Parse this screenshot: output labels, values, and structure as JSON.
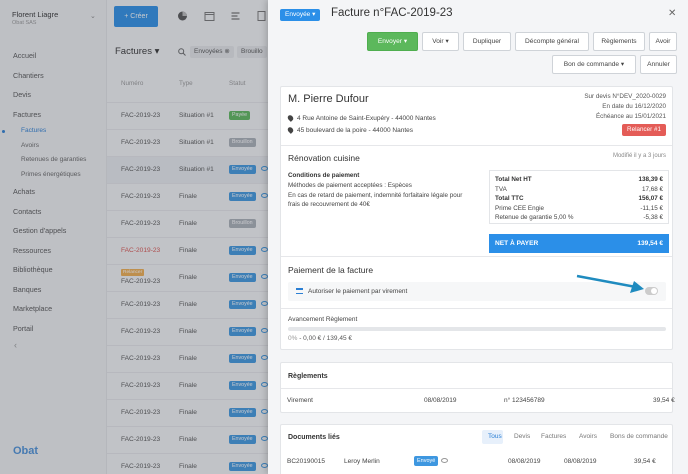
{
  "sidebar": {
    "user_name": "Florent Liagre",
    "company": "Obat SAS",
    "items": [
      {
        "label": "Accueil"
      },
      {
        "label": "Chantiers"
      },
      {
        "label": "Devis"
      },
      {
        "label": "Factures"
      },
      {
        "label": "Factures"
      },
      {
        "label": "Avoirs"
      },
      {
        "label": "Retenues de garanties"
      },
      {
        "label": "Primes énergétiques"
      },
      {
        "label": "Achats"
      },
      {
        "label": "Contacts"
      },
      {
        "label": "Gestion d'appels"
      },
      {
        "label": "Ressources"
      },
      {
        "label": "Bibliothèque"
      },
      {
        "label": "Banques"
      },
      {
        "label": "Marketplace"
      },
      {
        "label": "Portail"
      }
    ],
    "logo": "Obat"
  },
  "toolbar": {
    "create_label": "Créer"
  },
  "list": {
    "title": "Factures",
    "filters": [
      "Envoyées",
      "Brouillo"
    ],
    "columns": [
      "Numéro",
      "Type",
      "Statut"
    ],
    "rows": [
      {
        "num": "FAC-2019-23",
        "type": "Situation #1",
        "status": "Payée"
      },
      {
        "num": "FAC-2019-23",
        "type": "Situation #1",
        "status": "Brouillon"
      },
      {
        "num": "FAC-2019-23",
        "type": "Situation #1",
        "status": "Envoyée"
      },
      {
        "num": "FAC-2019-23",
        "type": "Finale",
        "status": "Envoyée"
      },
      {
        "num": "FAC-2019-23",
        "type": "Finale",
        "status": "Brouillon"
      },
      {
        "num": "FAC-2019-23",
        "type": "Finale",
        "status": "Envoyée"
      },
      {
        "num": "FAC-2019-23",
        "type": "Finale",
        "status": "Envoyée",
        "tag": "Relancer"
      },
      {
        "num": "FAC-2019-23",
        "type": "Finale",
        "status": "Envoyée"
      },
      {
        "num": "FAC-2019-23",
        "type": "Finale",
        "status": "Envoyée"
      },
      {
        "num": "FAC-2019-23",
        "type": "Finale",
        "status": "Envoyée"
      },
      {
        "num": "FAC-2019-23",
        "type": "Finale",
        "status": "Envoyée"
      },
      {
        "num": "FAC-2019-23",
        "type": "Finale",
        "status": "Envoyée"
      },
      {
        "num": "FAC-2019-23",
        "type": "Finale",
        "status": "Envoyée"
      },
      {
        "num": "FAC-2019-23",
        "type": "Finale",
        "status": "Envoyée"
      }
    ]
  },
  "panel": {
    "status": "Envoyée",
    "title": "Facture n°FAC-2019-23",
    "buttons": {
      "envoyer": "Envoyer",
      "voir": "Voir",
      "dupliquer": "Dupliquer",
      "decompte": "Décompte général",
      "reglements": "Règlements",
      "avoir": "Avoir",
      "bon_commande": "Bon de commande",
      "annuler": "Annuler"
    },
    "client": {
      "name": "M. Pierre Dufour",
      "address1": "4 Rue Antoine de Saint-Exupéry - 44000 Nantes",
      "address2": "45 boulevard de la poire - 44000 Nantes"
    },
    "meta": {
      "devis": "Sur devis N°DEV_2020-0029",
      "date": "En date du 16/12/2020",
      "echeance": "Échéance au 15/01/2021",
      "relancer": "Relancer #1"
    },
    "project": {
      "title": "Rénovation cuisine",
      "modified": "Modifié il y a 3 jours",
      "conditions_label": "Conditions de paiement",
      "conditions_line1": "Méthodes de paiement acceptées : Espèces",
      "conditions_line2": "En cas de retard de paiement, indemnité forfaitaire légale pour frais de recouvrement de 40€"
    },
    "totals": [
      {
        "label": "Total Net HT",
        "value": "138,39 €",
        "bold": true
      },
      {
        "label": "TVA",
        "value": "17,68 €",
        "bold": false
      },
      {
        "label": "Total TTC",
        "value": "156,07 €",
        "bold": true
      },
      {
        "label": "Prime CEE Engie",
        "value": "-11,15 €",
        "bold": false
      },
      {
        "label": "Retenue de garantie 5,00 %",
        "value": "-5,38 €",
        "bold": false
      }
    ],
    "net_label": "NET À PAYER",
    "net_value": "139,54 €",
    "payment": {
      "title": "Paiement de la facture",
      "virement_label": "Autoriser le paiement par virement",
      "virement_enabled": false,
      "progress_label": "Avancement Règlement",
      "progress_fraction": 0,
      "progress_pct": "0%",
      "progress_text": " - 0,00 € / 139,45 €"
    },
    "reglements": {
      "title": "Règlements",
      "row": {
        "mode": "Virement",
        "date": "08/08/2019",
        "ref": "n° 123456789",
        "amount": "39,54 €"
      }
    },
    "documents": {
      "title": "Documents liés",
      "tabs": [
        "Tous",
        "Devis",
        "Factures",
        "Avoirs",
        "Bons de commande"
      ],
      "row": {
        "num": "BC20190015",
        "supplier": "Leroy Merlin",
        "status": "Envoyé",
        "date1": "08/08/2019",
        "date2": "08/08/2019",
        "amount": "39,54 €"
      }
    }
  },
  "colors": {
    "accent": "#2b8fe8",
    "green": "#5cb85c",
    "red": "#e45c57",
    "arrow": "#1f8bbf"
  }
}
